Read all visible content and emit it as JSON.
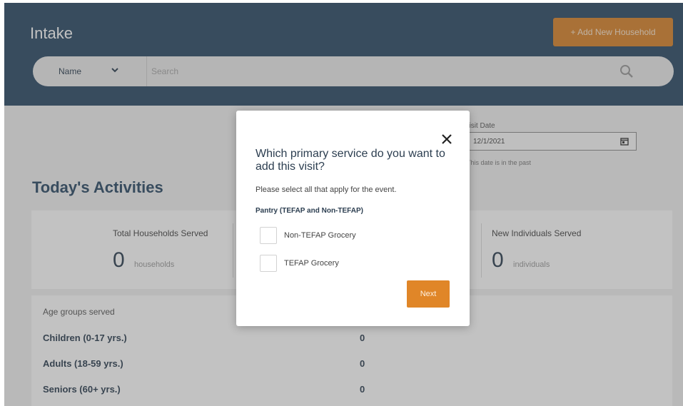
{
  "header": {
    "app_title": "Intake",
    "add_household_label": "+ Add New Household",
    "search_field_selected": "Name",
    "search_placeholder": "Search"
  },
  "visit": {
    "label": "Visit Date",
    "date_value": "12/1/2021",
    "note": "This date is in the past"
  },
  "activities": {
    "title": "Today's Activities",
    "stats": [
      {
        "label": "Total Households Served",
        "value": "0",
        "unit": "households"
      },
      {
        "label": "New Individuals Served",
        "value": "0",
        "unit": "individuals"
      }
    ],
    "age_groups": {
      "title": "Age groups served",
      "rows": [
        {
          "label": "Children (0-17 yrs.)",
          "value": "0"
        },
        {
          "label": "Adults (18-59 yrs.)",
          "value": "0"
        },
        {
          "label": "Seniors (60+ yrs.)",
          "value": "0"
        }
      ]
    }
  },
  "modal": {
    "heading": "Which primary service do you want to add this visit?",
    "subtitle": "Please select all that apply for the event.",
    "group_label": "Pantry (TEFAP and Non-TEFAP)",
    "options": [
      {
        "label": "Non-TEFAP Grocery",
        "checked": false
      },
      {
        "label": "TEFAP Grocery",
        "checked": false
      }
    ],
    "next_label": "Next"
  },
  "colors": {
    "header_bg": "#2c4a66",
    "accent_orange": "#d9832a",
    "title_blue": "#2c4a66"
  },
  "icons": [
    "chevron-down-icon",
    "search-icon",
    "calendar-icon",
    "close-icon"
  ]
}
